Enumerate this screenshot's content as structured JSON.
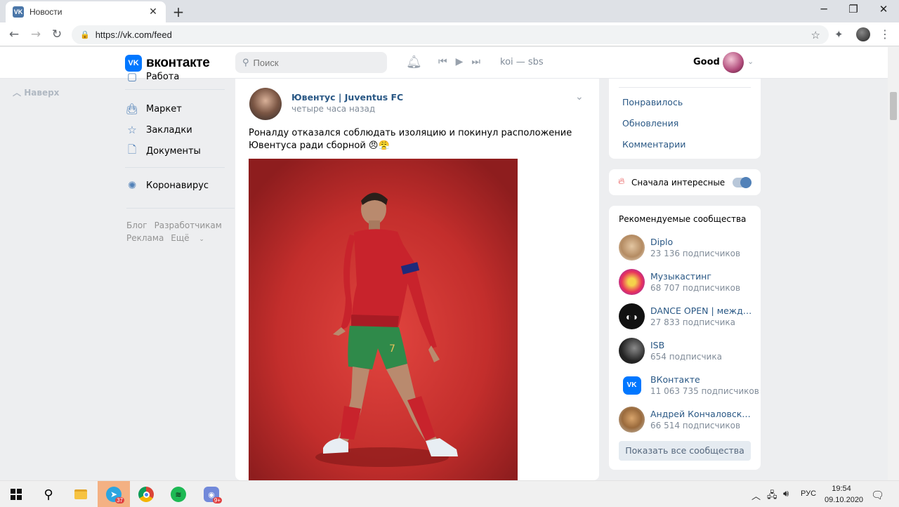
{
  "browser": {
    "tab_title": "Новости",
    "tab_favicon": "VK",
    "url": "https://vk.com/feed",
    "window_controls": [
      "minimize",
      "restore",
      "close"
    ]
  },
  "header": {
    "logo_icon": "VK",
    "logo_text": "вконтакте",
    "search_placeholder": "Поиск",
    "now_playing": "koi — sbs",
    "username": "Good"
  },
  "left_nav": {
    "up_label": "Наверх",
    "items": [
      {
        "label": "Работа",
        "icon": "briefcase-icon"
      },
      {
        "label": "Маркет",
        "icon": "bag-icon"
      },
      {
        "label": "Закладки",
        "icon": "star-icon"
      },
      {
        "label": "Документы",
        "icon": "document-icon"
      },
      {
        "label": "Коронавирус",
        "icon": "virus-icon"
      }
    ],
    "footer": [
      "Блог",
      "Разработчикам",
      "Реклама",
      "Ещё"
    ]
  },
  "post": {
    "author": "Ювентус | Juventus FC",
    "time": "четыре часа назад",
    "text": "Роналду отказался соблюдать изоляцию и покинул расположение Ювентуса ради сборной 😠😤",
    "player_number": "7"
  },
  "right_menu": {
    "links": [
      "Понравилось",
      "Обновления",
      "Комментарии"
    ],
    "toggle_label": "Сначала интересные",
    "toggle_on": true
  },
  "communities": {
    "header": "Рекомендуемые сообщества",
    "items": [
      {
        "name": "Diplo",
        "subs": "23 136 подписчиков"
      },
      {
        "name": "Музыкастинг",
        "subs": "68 707 подписчиков"
      },
      {
        "name": "DANCE OPEN | международный",
        "subs": "27 833 подписчика"
      },
      {
        "name": "ISB",
        "subs": "654 подписчика"
      },
      {
        "name": "ВКонтакте",
        "subs": "11 063 735 подписчиков"
      },
      {
        "name": "Андрей Кончаловский",
        "subs": "66 514 подписчиков"
      }
    ],
    "show_all": "Показать все сообщества"
  },
  "taskbar": {
    "telegram_badge": "37",
    "discord_badge": "9+",
    "lang": "РУС",
    "time": "19:54",
    "date": "09.10.2020"
  },
  "colors": {
    "vk_blue": "#0077ff",
    "link": "#2a5885",
    "bg": "#edeef0"
  }
}
